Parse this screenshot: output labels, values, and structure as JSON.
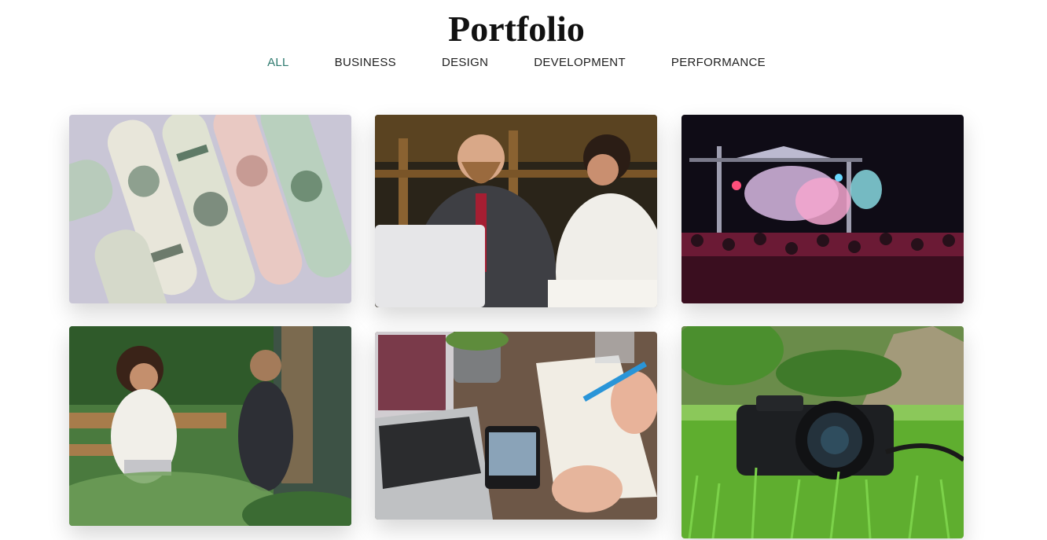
{
  "header": {
    "title": "Portfolio"
  },
  "filters": [
    {
      "label": "ALL",
      "active": true
    },
    {
      "label": "BUSINESS",
      "active": false
    },
    {
      "label": "DESIGN",
      "active": false
    },
    {
      "label": "DEVELOPMENT",
      "active": false
    },
    {
      "label": "PERFORMANCE",
      "active": false
    }
  ],
  "portfolio_items": [
    {
      "subject": "rolled dollar bills"
    },
    {
      "subject": "business meeting with laptop"
    },
    {
      "subject": "concert crowd with stage lights"
    },
    {
      "subject": "outdoor meeting at cafe table"
    },
    {
      "subject": "laptop, phone and notebook on desk"
    },
    {
      "subject": "camera lying in grass"
    }
  ],
  "colors": {
    "accent": "#2f7a6f",
    "text": "#1f1f1f",
    "background": "#ffffff"
  }
}
